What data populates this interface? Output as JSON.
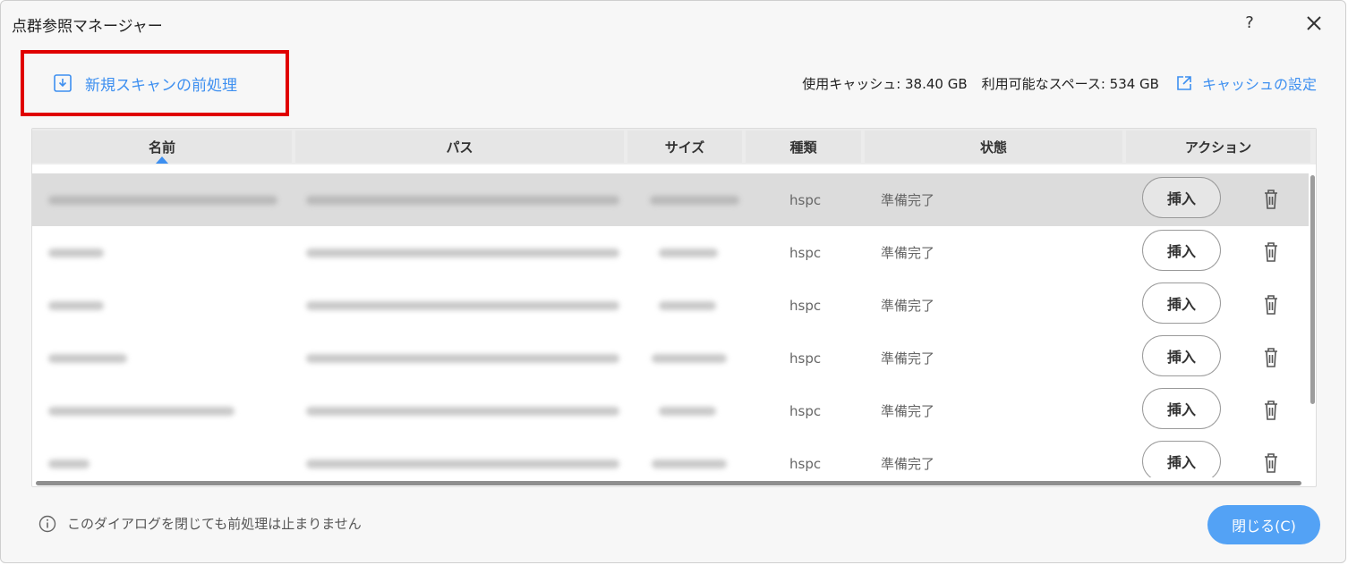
{
  "window": {
    "title": "点群参照マネージャー",
    "help_label": "?"
  },
  "toolbar": {
    "preprocess_label": "新規スキャンの前処理",
    "cache_used_label": "使用キャッシュ: 38.40 GB",
    "space_available_label": "利用可能なスペース: 534 GB",
    "cache_settings_label": "キャッシュの設定"
  },
  "table": {
    "columns": [
      "名前",
      "パス",
      "サイズ",
      "種類",
      "状態",
      "アクション"
    ],
    "sort_column": "名前",
    "rows": [
      {
        "type": "hspc",
        "status": "準備完了",
        "action": "挿入",
        "selected": true
      },
      {
        "type": "hspc",
        "status": "準備完了",
        "action": "挿入"
      },
      {
        "type": "hspc",
        "status": "準備完了",
        "action": "挿入"
      },
      {
        "type": "hspc",
        "status": "準備完了",
        "action": "挿入"
      },
      {
        "type": "hspc",
        "status": "準備完了",
        "action": "挿入"
      },
      {
        "type": "hspc",
        "status": "準備完了",
        "action": "挿入"
      }
    ]
  },
  "footer": {
    "note": "このダイアログを閉じても前処理は止まりません",
    "close_label": "閉じる(C)"
  },
  "colors": {
    "accent": "#3d8ff0",
    "primary_button": "#53a2f5",
    "highlight": "#e00000"
  }
}
